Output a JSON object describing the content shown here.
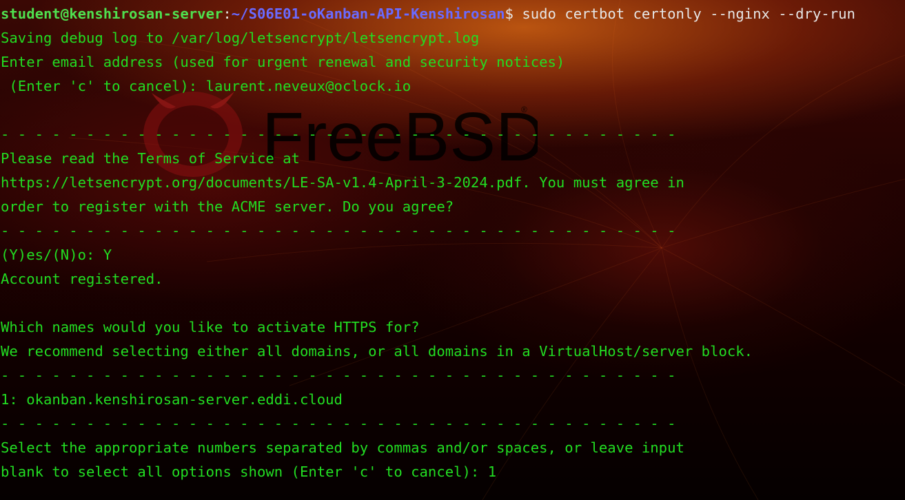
{
  "wallpaper": {
    "logo_text": "FreeBSD",
    "logo_mark": "®",
    "icon": "freebsd-daemon-logo"
  },
  "prompt": {
    "user_host": "student@kenshirosan-server",
    "colon": ":",
    "path": "~/S06E01-oKanban-API-Kenshirosan",
    "dollar": "$",
    "command": " sudo certbot certonly --nginx --dry-run"
  },
  "output": {
    "debug_log": "Saving debug log to /var/log/letsencrypt/letsencrypt.log",
    "email_prompt_1": "Enter email address (used for urgent renewal and security notices)",
    "email_prompt_2": " (Enter 'c' to cancel): laurent.neveux@oclock.io",
    "separator": "- - - - - - - - - - - - - - - - - - - - - - - - - - - - - - - - - - - - - - - -",
    "tos_1": "Please read the Terms of Service at",
    "tos_2": "https://letsencrypt.org/documents/LE-SA-v1.4-April-3-2024.pdf. You must agree in",
    "tos_3": "order to register with the ACME server. Do you agree?",
    "yes_no": "(Y)es/(N)o: Y",
    "registered": "Account registered.",
    "names_q": "Which names would you like to activate HTTPS for?",
    "recommend": "We recommend selecting either all domains, or all domains in a VirtualHost/server block.",
    "domain_option": "1: okanban.kenshirosan-server.eddi.cloud",
    "select_1": "Select the appropriate numbers separated by commas and/or spaces, or leave input",
    "select_2": "blank to select all options shown (Enter 'c' to cancel): 1"
  },
  "colors": {
    "text": "#22dd22",
    "prompt_user": "#4fe04f",
    "prompt_path": "#6a6aff",
    "command": "#e6e6e6"
  }
}
